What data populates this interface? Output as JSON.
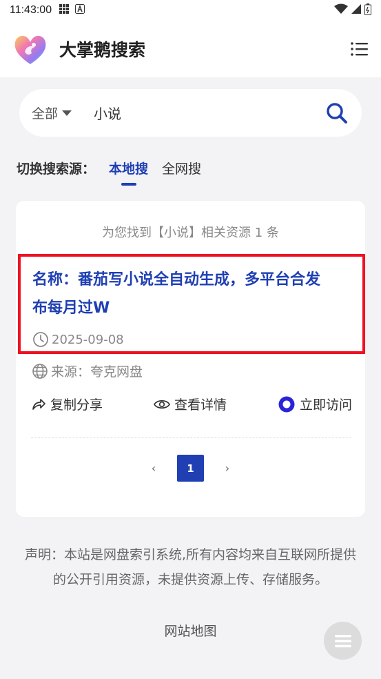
{
  "status_bar": {
    "time": "11:43:00"
  },
  "app": {
    "title": "大掌鹅搜索"
  },
  "search": {
    "scope": "全部",
    "query": "小说"
  },
  "source_switch": {
    "label": "切换搜索源：",
    "tabs": [
      "本地搜",
      "全网搜"
    ]
  },
  "results": {
    "summary": "为您找到【小说】相关资源 1 条",
    "item": {
      "title_line1": "名称：番茄写小说全自动生成，多平台合发",
      "title_line2": "布每月过W",
      "date": "2025-09-08",
      "source": "来源：夸克网盘"
    },
    "actions": {
      "copy": "复制分享",
      "view": "查看详情",
      "visit": "立即访问"
    }
  },
  "pagination": {
    "current": "1",
    "prev": "‹",
    "next": "›"
  },
  "footer": {
    "disclaimer": "声明：本站是网盘索引系统,所有内容均来自互联网所提供的公开引用资源，未提供资源上传、存储服务。",
    "sitemap": "网站地图"
  },
  "colors": {
    "accent": "#1f3fb3",
    "highlight_border": "#ee1122",
    "background": "#f3f3f5"
  }
}
